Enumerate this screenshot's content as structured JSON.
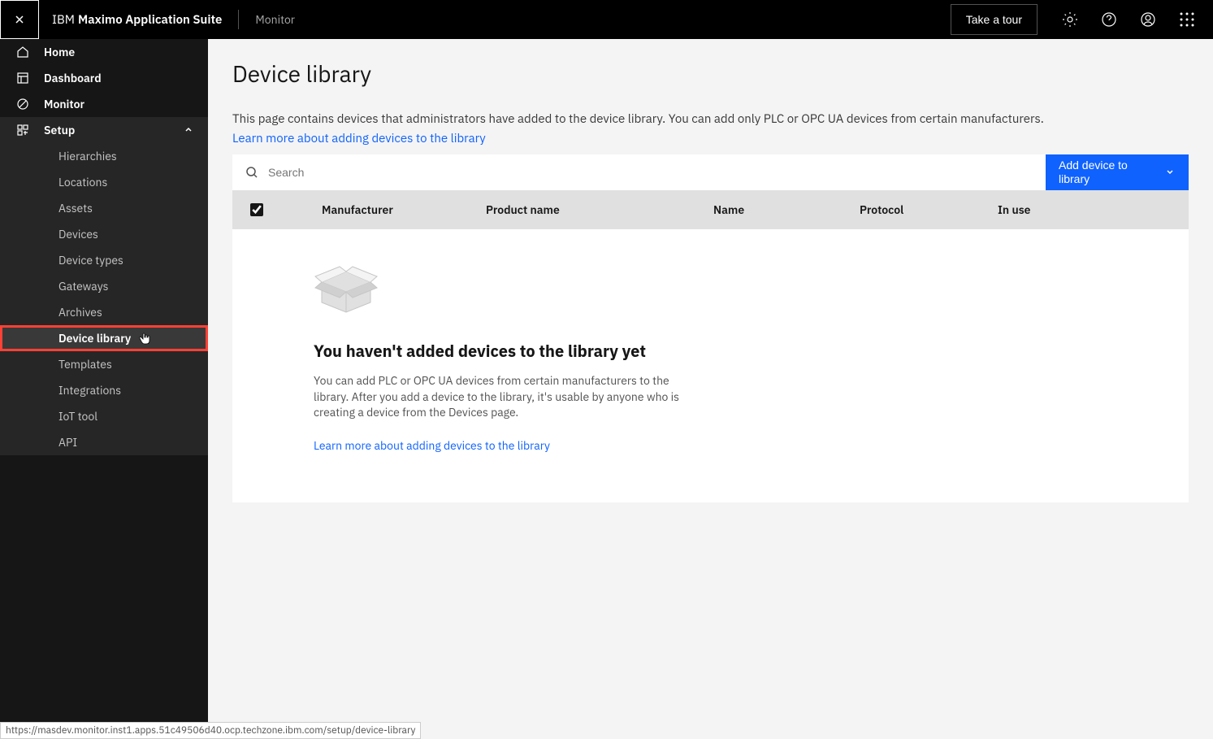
{
  "header": {
    "brand_ibm": "IBM",
    "brand_main": "Maximo Application Suite",
    "breadcrumb": "Monitor",
    "take_tour": "Take a tour"
  },
  "sidebar": {
    "home": "Home",
    "dashboard": "Dashboard",
    "monitor": "Monitor",
    "setup": "Setup",
    "sub": {
      "hierarchies": "Hierarchies",
      "locations": "Locations",
      "assets": "Assets",
      "devices": "Devices",
      "device_types": "Device types",
      "gateways": "Gateways",
      "archives": "Archives",
      "device_library": "Device library",
      "templates": "Templates",
      "integrations": "Integrations",
      "iot_tool": "IoT tool",
      "api": "API"
    }
  },
  "main": {
    "title": "Device library",
    "description": "This page contains devices that administrators have added to the device library. You can add only PLC or OPC UA devices from certain manufacturers.",
    "learn_more": "Learn more about adding devices to the library",
    "search_placeholder": "Search",
    "add_button": "Add device to library",
    "columns": {
      "manufacturer": "Manufacturer",
      "product_name": "Product name",
      "name": "Name",
      "protocol": "Protocol",
      "in_use": "In use"
    },
    "empty": {
      "title": "You haven't added devices to the library yet",
      "description": "You can add PLC or OPC UA devices from certain manufacturers to the library. After you add a device to the library, it's usable by anyone who is creating a device from the Devices page.",
      "link": "Learn more about adding devices to the library"
    }
  },
  "status_bar": "https://masdev.monitor.inst1.apps.51c49506d40.ocp.techzone.ibm.com/setup/device-library"
}
